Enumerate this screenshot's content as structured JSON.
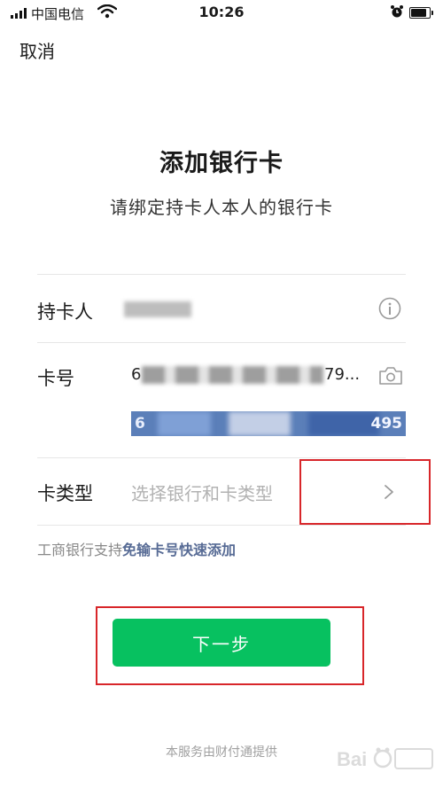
{
  "status_bar": {
    "carrier": "中国电信",
    "time": "10:26"
  },
  "nav": {
    "cancel_label": "取消"
  },
  "header": {
    "title": "添加银行卡",
    "subtitle": "请绑定持卡人本人的银行卡"
  },
  "form": {
    "holder_label": "持卡人",
    "card_number_label": "卡号",
    "card_number_prefix": "6",
    "card_number_suffix": "79...",
    "card_image_leading": "6",
    "card_image_trailing": "495",
    "card_type_label": "卡类型",
    "card_type_placeholder": "选择银行和卡类型"
  },
  "promo": {
    "prefix": "工商银行支持",
    "link": "免输卡号快速添加"
  },
  "actions": {
    "next_label": "下一步"
  },
  "footer": {
    "text": "本服务由财付通提供"
  },
  "colors": {
    "accent_green": "#07c160",
    "link_blue": "#576b95",
    "annotation_red": "#d8262a"
  }
}
